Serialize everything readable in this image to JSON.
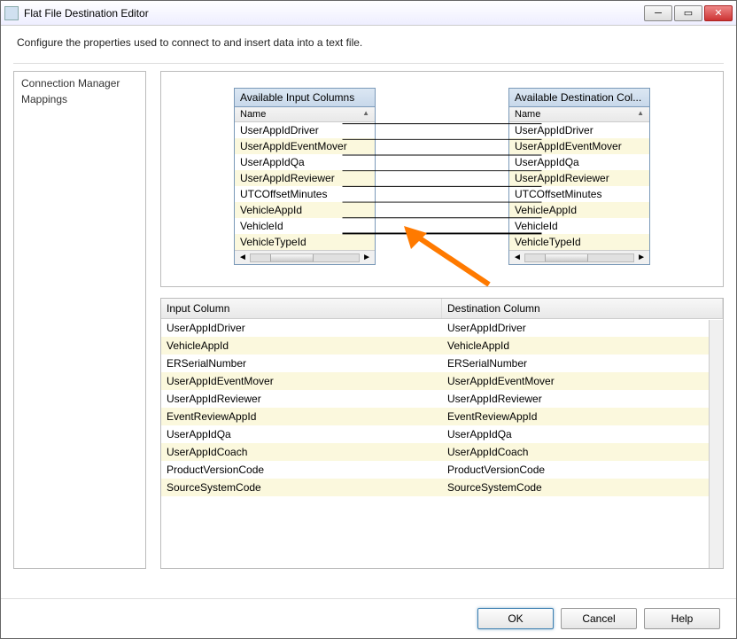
{
  "window": {
    "title": "Flat File Destination Editor",
    "instruction": "Configure the properties used to connect to and insert data into a text file."
  },
  "sidebar": [
    "Connection Manager",
    "Mappings"
  ],
  "mapper": {
    "inputHeader": "Available Input Columns",
    "destHeader": "Available Destination Col...",
    "nameCol": "Name",
    "inputItems": [
      "UserAppIdDriver",
      "UserAppIdEventMover",
      "UserAppIdQa",
      "UserAppIdReviewer",
      "UTCOffsetMinutes",
      "VehicleAppId",
      "VehicleId",
      "VehicleTypeId"
    ],
    "destItems": [
      "UserAppIdDriver",
      "UserAppIdEventMover",
      "UserAppIdQa",
      "UserAppIdReviewer",
      "UTCOffsetMinutes",
      "VehicleAppId",
      "VehicleId",
      "VehicleTypeId"
    ]
  },
  "grid": {
    "headers": [
      "Input Column",
      "Destination Column"
    ],
    "rows": [
      [
        "UserAppIdDriver",
        "UserAppIdDriver"
      ],
      [
        "VehicleAppId",
        "VehicleAppId"
      ],
      [
        "ERSerialNumber",
        "ERSerialNumber"
      ],
      [
        "UserAppIdEventMover",
        "UserAppIdEventMover"
      ],
      [
        "UserAppIdReviewer",
        "UserAppIdReviewer"
      ],
      [
        "EventReviewAppId",
        "EventReviewAppId"
      ],
      [
        "UserAppIdQa",
        "UserAppIdQa"
      ],
      [
        "UserAppIdCoach",
        "UserAppIdCoach"
      ],
      [
        "ProductVersionCode",
        "ProductVersionCode"
      ],
      [
        "SourceSystemCode",
        "SourceSystemCode"
      ]
    ]
  },
  "footer": {
    "ok": "OK",
    "cancel": "Cancel",
    "help": "Help"
  }
}
